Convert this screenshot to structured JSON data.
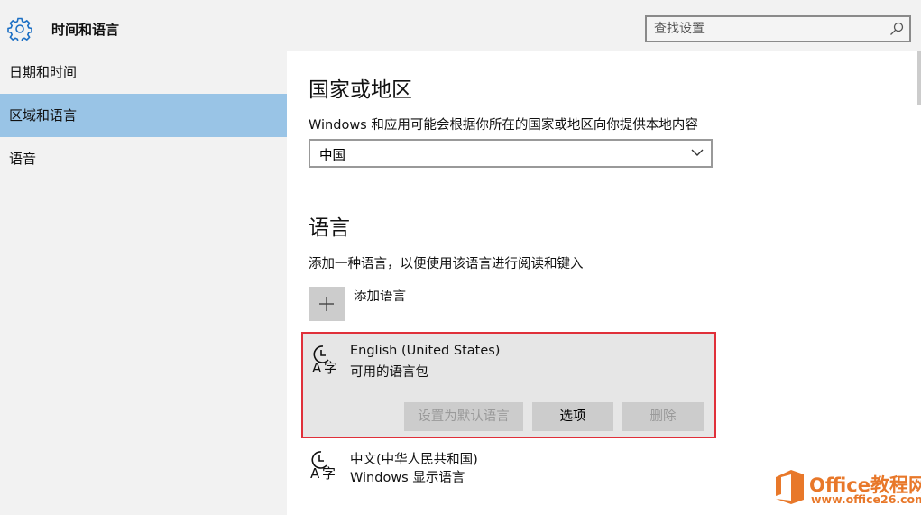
{
  "header": {
    "title": "时间和语言",
    "search_placeholder": "查找设置"
  },
  "sidebar": {
    "items": [
      {
        "label": "日期和时间",
        "active": false
      },
      {
        "label": "区域和语言",
        "active": true
      },
      {
        "label": "语音",
        "active": false
      }
    ]
  },
  "region": {
    "heading": "国家或地区",
    "description": "Windows 和应用可能会根据你所在的国家或地区向你提供本地内容",
    "selected": "中国"
  },
  "language": {
    "heading": "语言",
    "description": "添加一种语言，以便使用该语言进行阅读和键入",
    "add_label": "添加语言",
    "items": [
      {
        "name": "English (United States)",
        "status": "可用的语言包",
        "buttons": {
          "set_default": "设置为默认语言",
          "options": "选项",
          "remove": "删除"
        }
      },
      {
        "name": "中文(中华人民共和国)",
        "status": "Windows 显示语言"
      }
    ]
  },
  "watermark": {
    "brand_office": "Office",
    "brand_cn": "教程网",
    "url": "www.office26.com"
  },
  "colors": {
    "accent": "#99c4e6",
    "highlight_border": "#e0303a",
    "logo": "#e8782a"
  }
}
